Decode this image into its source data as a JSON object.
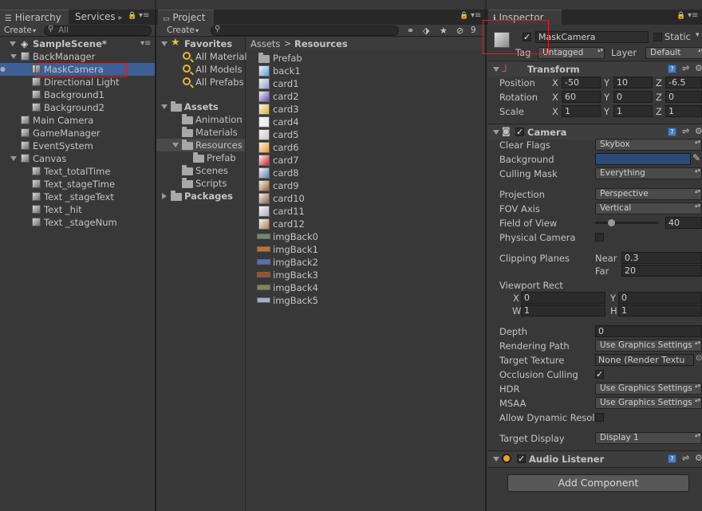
{
  "hierarchy": {
    "tabs": [
      "Hierarchy",
      "Services"
    ],
    "create_label": "Create",
    "search_placeholder": "All",
    "scene": "SampleScene*",
    "items": [
      {
        "label": "BackManager",
        "level": 1,
        "expanded": true
      },
      {
        "label": "MaskCamera",
        "level": 2,
        "selected": true
      },
      {
        "label": "Directional Light",
        "level": 2
      },
      {
        "label": "Background1",
        "level": 2
      },
      {
        "label": "Background2",
        "level": 2
      },
      {
        "label": "Main Camera",
        "level": 1
      },
      {
        "label": "GameManager",
        "level": 1
      },
      {
        "label": "EventSystem",
        "level": 1
      },
      {
        "label": "Canvas",
        "level": 1,
        "expanded": true
      },
      {
        "label": "Text_totalTime",
        "level": 2
      },
      {
        "label": "Text_stageTime",
        "level": 2
      },
      {
        "label": "Text _stageText",
        "level": 2
      },
      {
        "label": "Text _hit",
        "level": 2
      },
      {
        "label": "Text _stageNum",
        "level": 2
      }
    ]
  },
  "project": {
    "tab": "Project",
    "create_label": "Create",
    "badge": "9",
    "favorites_label": "Favorites",
    "favorites": [
      "All Material",
      "All Models",
      "All Prefabs"
    ],
    "assets_label": "Assets",
    "assets_children": [
      "Animation",
      "Materials",
      "Resources",
      "Prefab",
      "Scenes",
      "Scripts"
    ],
    "packages_label": "Packages",
    "breadcrumb": [
      "Assets",
      "Resources"
    ],
    "files": [
      {
        "name": "Prefab",
        "kind": "folder"
      },
      {
        "name": "back1",
        "kind": "thumb",
        "color": "#5aa0d8"
      },
      {
        "name": "card1",
        "kind": "thumb",
        "color": "#8aa0c8"
      },
      {
        "name": "card2",
        "kind": "thumb",
        "color": "#6a4ab8"
      },
      {
        "name": "card3",
        "kind": "thumb",
        "color": "#e0b030"
      },
      {
        "name": "card4",
        "kind": "thumb",
        "color": "#e8e8e8"
      },
      {
        "name": "card5",
        "kind": "thumb",
        "color": "#c8c8c8"
      },
      {
        "name": "card6",
        "kind": "thumb",
        "color": "#e89820"
      },
      {
        "name": "card7",
        "kind": "thumb",
        "color": "#d02020"
      },
      {
        "name": "card8",
        "kind": "thumb",
        "color": "#6080b0"
      },
      {
        "name": "card9",
        "kind": "thumb",
        "color": "#a06030"
      },
      {
        "name": "card10",
        "kind": "thumb",
        "color": "#8a6040"
      },
      {
        "name": "card11",
        "kind": "thumb",
        "color": "#b0b0c0"
      },
      {
        "name": "card12",
        "kind": "thumb",
        "color": "#b08050"
      },
      {
        "name": "imgBack0",
        "kind": "wide",
        "color": "#6a8a6a"
      },
      {
        "name": "imgBack1",
        "kind": "wide",
        "color": "#c07030"
      },
      {
        "name": "imgBack2",
        "kind": "wide",
        "color": "#5070c0"
      },
      {
        "name": "imgBack3",
        "kind": "wide",
        "color": "#a05020"
      },
      {
        "name": "imgBack4",
        "kind": "wide",
        "color": "#7a8a5a"
      },
      {
        "name": "imgBack5",
        "kind": "wide",
        "color": "#a0b0d0"
      }
    ]
  },
  "inspector": {
    "tab": "Inspector",
    "object_name": "MaskCamera",
    "static_label": "Static",
    "tag_label": "Tag",
    "tag_value": "Untagged",
    "layer_label": "Layer",
    "layer_value": "Default",
    "transform": {
      "title": "Transform",
      "position_label": "Position",
      "position": [
        "-50",
        "10",
        "-6.5"
      ],
      "rotation_label": "Rotation",
      "rotation": [
        "60",
        "0",
        "0"
      ],
      "scale_label": "Scale",
      "scale": [
        "1",
        "1",
        "1"
      ],
      "axes": [
        "X",
        "Y",
        "Z"
      ]
    },
    "camera": {
      "title": "Camera",
      "clear_flags_label": "Clear Flags",
      "clear_flags": "Skybox",
      "background_label": "Background",
      "background_color": "#2b4a78",
      "culling_mask_label": "Culling Mask",
      "culling_mask": "Everything",
      "projection_label": "Projection",
      "projection": "Perspective",
      "fov_axis_label": "FOV Axis",
      "fov_axis": "Vertical",
      "fov_label": "Field of View",
      "fov_value": "40",
      "fov_fraction": 0.22,
      "physical_label": "Physical Camera",
      "clipping_label": "Clipping Planes",
      "near_label": "Near",
      "near": "0.3",
      "far_label": "Far",
      "far": "20",
      "viewport_label": "Viewport Rect",
      "vp_x_label": "X",
      "vp_x": "0",
      "vp_y_label": "Y",
      "vp_y": "0",
      "vp_w_label": "W",
      "vp_w": "1",
      "vp_h_label": "H",
      "vp_h": "1",
      "depth_label": "Depth",
      "depth": "0",
      "rendering_path_label": "Rendering Path",
      "rendering_path": "Use Graphics Settings",
      "target_texture_label": "Target Texture",
      "target_texture": "None (Render Textu",
      "occlusion_label": "Occlusion Culling",
      "hdr_label": "HDR",
      "hdr": "Use Graphics Settings",
      "msaa_label": "MSAA",
      "msaa": "Use Graphics Settings",
      "dynres_label": "Allow Dynamic Resol",
      "target_display_label": "Target Display",
      "target_display": "Display 1"
    },
    "audio": {
      "title": "Audio Listener"
    },
    "add_component": "Add Component"
  }
}
